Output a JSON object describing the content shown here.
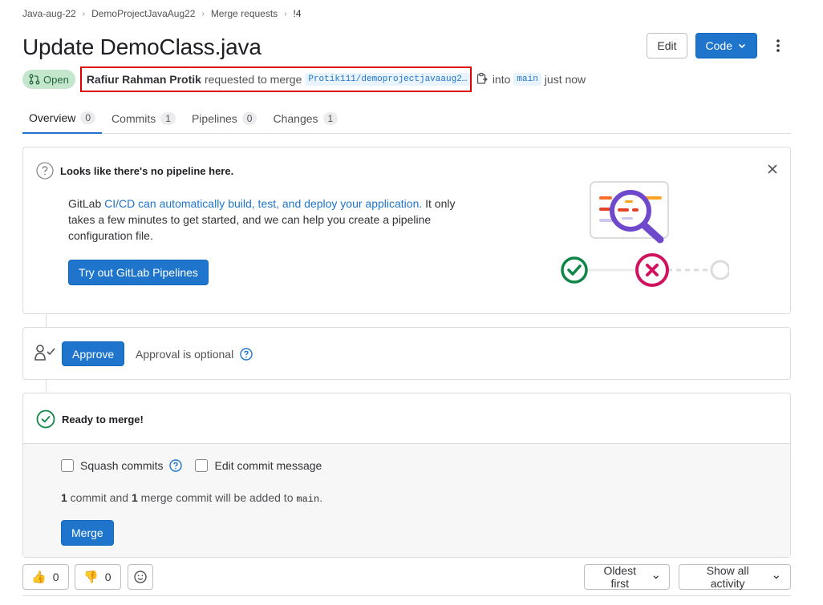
{
  "breadcrumb": {
    "items": [
      "Java-aug-22",
      "DemoProjectJavaAug22",
      "Merge requests",
      "!4"
    ]
  },
  "header": {
    "title": "Update DemoClass.java",
    "edit_label": "Edit",
    "code_label": "Code"
  },
  "meta": {
    "status": "Open",
    "author": "Rafiur Rahman Protik",
    "action": "requested to merge",
    "source_branch": "Protik111/demoprojectjavaaug2…",
    "into": "into",
    "target_branch": "main",
    "time": "just now"
  },
  "tabs": [
    {
      "label": "Overview",
      "count": "0"
    },
    {
      "label": "Commits",
      "count": "1"
    },
    {
      "label": "Pipelines",
      "count": "0"
    },
    {
      "label": "Changes",
      "count": "1"
    }
  ],
  "pipeline_card": {
    "heading": "Looks like there's no pipeline here.",
    "text_prefix": "GitLab ",
    "link_text": "CI/CD can automatically build, test, and deploy your application.",
    "text_suffix": " It only takes a few minutes to get started, and we can help you create a pipeline configuration file.",
    "button": "Try out GitLab Pipelines"
  },
  "approval": {
    "button": "Approve",
    "text": "Approval is optional"
  },
  "merge": {
    "heading": "Ready to merge!",
    "squash_label": "Squash commits",
    "edit_label": "Edit commit message",
    "commit_count": "1",
    "commit_text_a": " commit and ",
    "merge_count": "1",
    "commit_text_b": " merge commit will be added to ",
    "branch": "main",
    "period": ".",
    "button": "Merge"
  },
  "reactions": {
    "thumbs_up_count": "0",
    "thumbs_down_count": "0"
  },
  "activity": {
    "sort_label": "Oldest first",
    "filter_label": "Show all activity"
  },
  "colors": {
    "primary": "#1f75cb",
    "open_badge_bg": "#c3e6cd",
    "success": "#108548",
    "danger": "#dd2b0e",
    "highlight": "#dd0000"
  }
}
